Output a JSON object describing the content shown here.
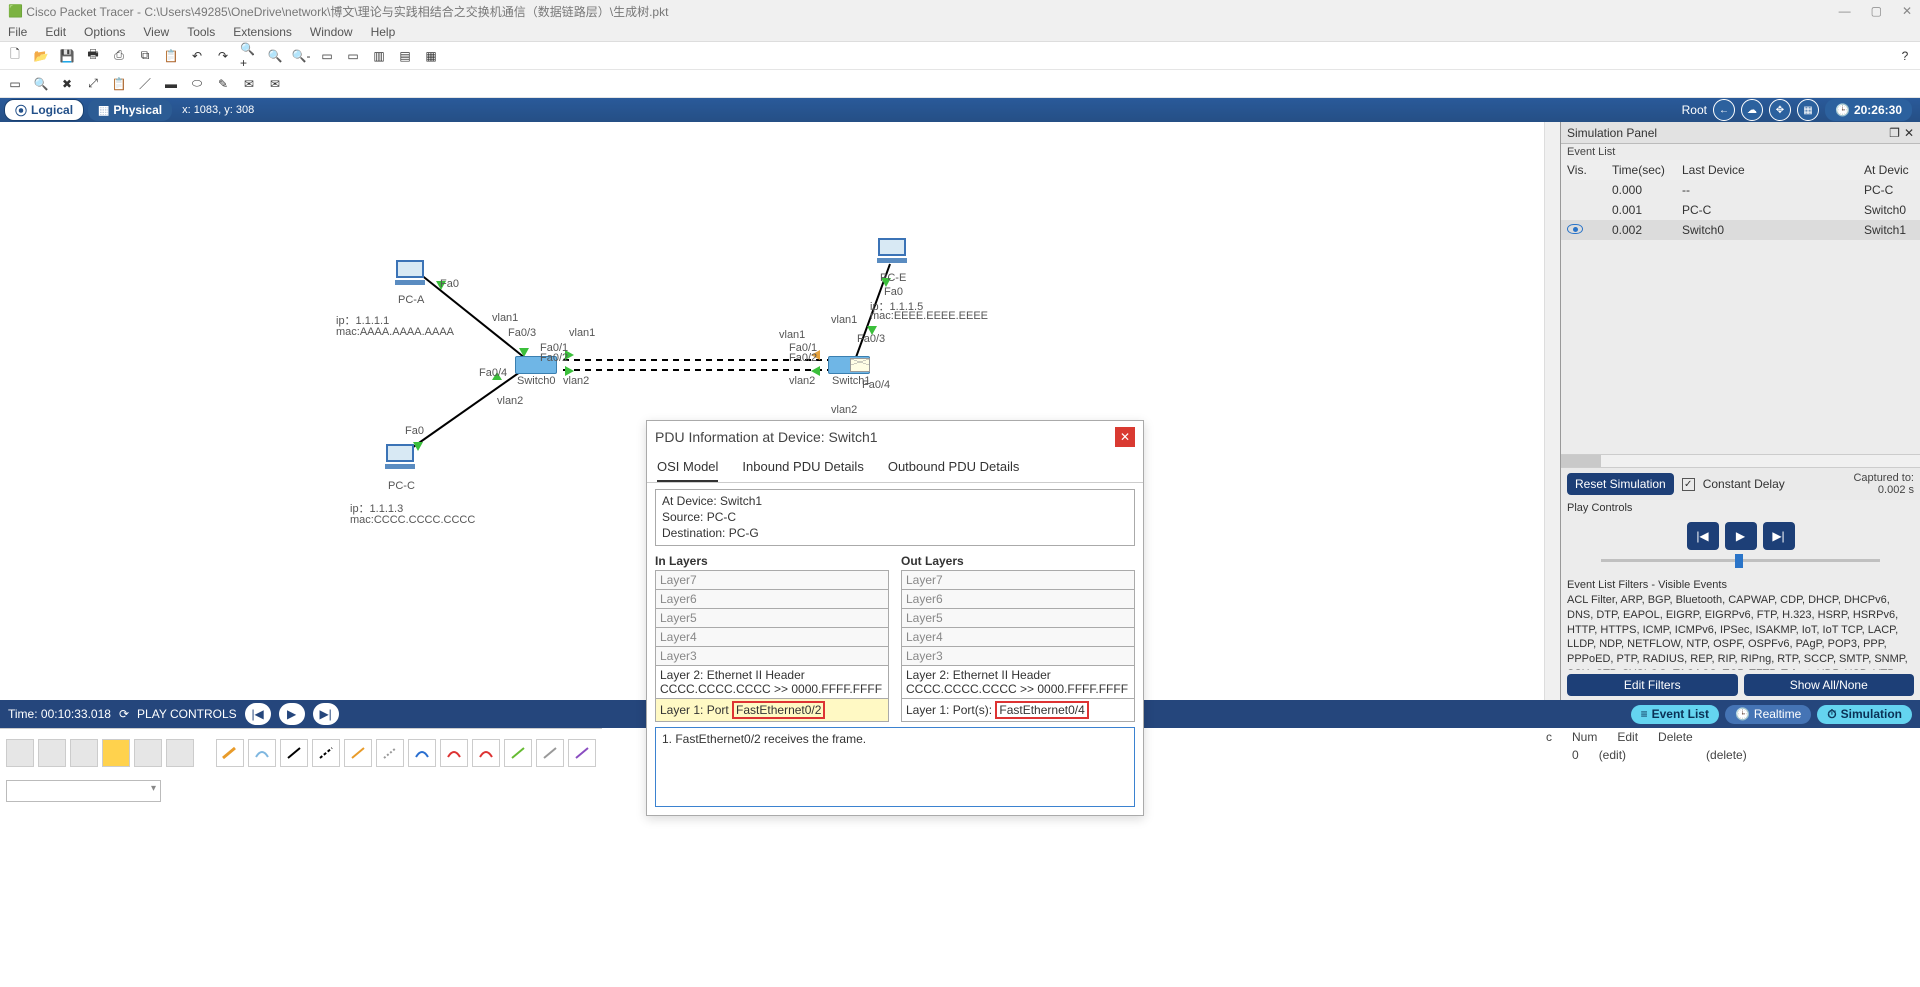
{
  "title": "Cisco Packet Tracer - C:\\Users\\49285\\OneDrive\\network\\博文\\理论与实践相结合之交换机通信（数据链路层）\\生成树.pkt",
  "menu": [
    "File",
    "Edit",
    "Options",
    "View",
    "Tools",
    "Extensions",
    "Window",
    "Help"
  ],
  "view": {
    "logical": "Logical",
    "physical": "Physical",
    "coords": "x: 1083, y: 308",
    "root": "Root",
    "clock": "20:26:30"
  },
  "ctrl": {
    "time": "Time: 00:10:33.018",
    "play": "PLAY CONTROLS",
    "evlist": "Event List",
    "realtime": "Realtime",
    "simulation": "Simulation"
  },
  "canvas": {
    "pca": {
      "name": "PC-A",
      "ip": "ip：1.1.1.1",
      "mac": "mac:AAAA.AAAA.AAAA",
      "port": "Fa0"
    },
    "pcc": {
      "name": "PC-C",
      "ip": "ip：1.1.1.3",
      "mac": "mac:CCCC.CCCC.CCCC",
      "port": "Fa0"
    },
    "pce": {
      "name": "PC-E",
      "ip": "ip：1.1.1.5",
      "mac": "mac:EEEE.EEEE.EEEE",
      "port": "Fa0"
    },
    "sw0": "Switch0",
    "sw1": "Switch1",
    "p": {
      "fa03": "Fa0/3",
      "fa04": "Fa0/4",
      "fa02": "Fa0/2",
      "fa01": "Fa0/1",
      "vlan1": "vlan1",
      "vlan2": "vlan2"
    }
  },
  "pdu": {
    "title": "PDU Information at Device: Switch1",
    "tabs": {
      "osi": "OSI Model",
      "in": "Inbound PDU Details",
      "out": "Outbound PDU Details"
    },
    "meta": {
      "l1": "At Device: Switch1",
      "l2": "Source: PC-C",
      "l3": "Destination: PC-G"
    },
    "inTitle": "In Layers",
    "outTitle": "Out Layers",
    "layers": [
      "Layer7",
      "Layer6",
      "Layer5",
      "Layer4",
      "Layer3"
    ],
    "inL2": "Layer 2: Ethernet II Header CCCC.CCCC.CCCC >> 0000.FFFF.FFFF",
    "inL1a": "Layer 1: Port ",
    "inL1b": "FastEthernet0/2",
    "outL2": "Layer 2: Ethernet II Header CCCC.CCCC.CCCC >> 0000.FFFF.FFFF",
    "outL1a": "Layer 1: Port(s): ",
    "outL1b": "FastEthernet0/4",
    "log": "1. FastEthernet0/2 receives the frame."
  },
  "sim": {
    "title": "Simulation Panel",
    "evlist": "Event List",
    "head": {
      "vis": "Vis.",
      "time": "Time(sec)",
      "last": "Last Device",
      "at": "At Devic"
    },
    "rows": [
      {
        "time": "0.000",
        "last": "--",
        "at": "PC-C"
      },
      {
        "time": "0.001",
        "last": "PC-C",
        "at": "Switch0"
      },
      {
        "time": "0.002",
        "last": "Switch0",
        "at": "Switch1"
      }
    ],
    "reset": "Reset Simulation",
    "delay": "Constant Delay",
    "cap1": "Captured to:",
    "cap2": "0.002 s",
    "playTitle": "Play Controls",
    "filtTitle": "Event List Filters - Visible Events",
    "filters": "ACL Filter, ARP, BGP, Bluetooth, CAPWAP, CDP, DHCP, DHCPv6, DNS, DTP, EAPOL, EIGRP, EIGRPv6, FTP, H.323, HSRP, HSRPv6, HTTP, HTTPS, ICMP, ICMPv6, IPSec, ISAKMP, IoT, IoT TCP, LACP, LLDP, NDP, NETFLOW, NTP, OSPF, OSPFv6, PAgP, POP3, PPP, PPPoED, PTP, RADIUS, REP, RIP, RIPng, RTP, SCCP, SMTP, SNMP, SSH, STP, SYSLOG, TACACS, TCP, TFTP, Telnet, UDP, USB, VTP",
    "editFilters": "Edit Filters",
    "showAll": "Show All/None"
  },
  "bot": {
    "h1": "c",
    "h2": "Num",
    "h3": "Edit",
    "h4": "Delete",
    "r2": "0",
    "r3": "(edit)",
    "r4": "(delete)"
  }
}
